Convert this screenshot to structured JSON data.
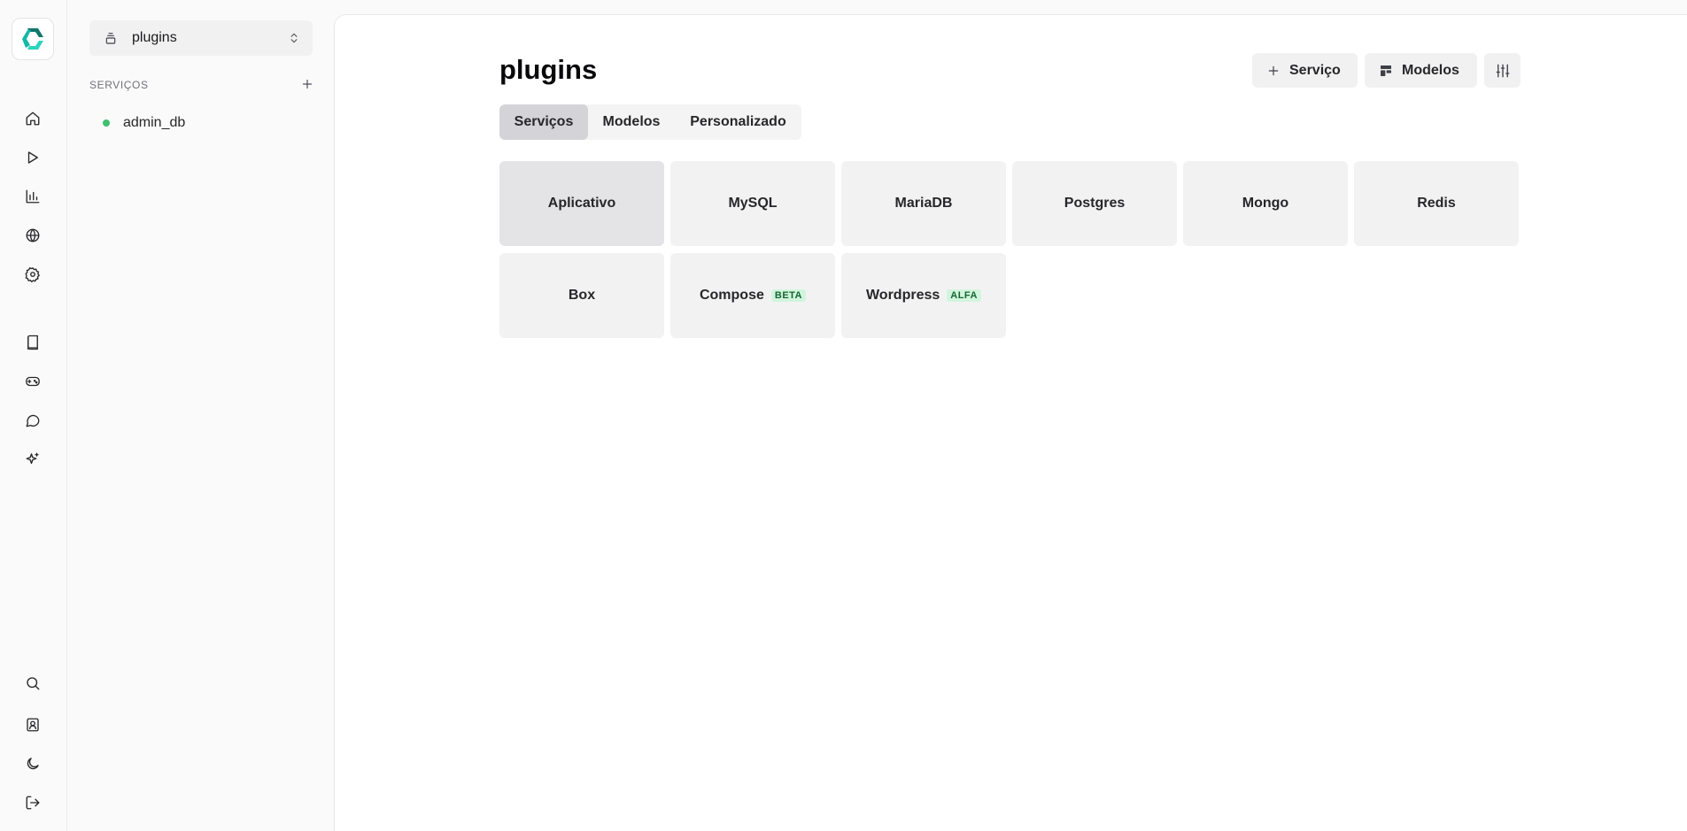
{
  "sidebar_rail": {
    "logo": "dokploy-logo",
    "top_icons": [
      "home-icon",
      "play-icon",
      "bar-chart-icon",
      "globe-icon",
      "settings-icon"
    ],
    "mid_icons": [
      "book-icon",
      "gamepad-icon",
      "message-circle-icon",
      "sparkles-icon"
    ],
    "bottom_icons": [
      "search-icon",
      "user-badge-icon",
      "moon-icon",
      "logout-icon"
    ]
  },
  "panel": {
    "project_name": "plugins",
    "section_title": "SERVIÇOS",
    "services": [
      {
        "name": "admin_db",
        "status_color": "#3fbf6f"
      }
    ]
  },
  "main": {
    "title": "plugins",
    "actions": {
      "service_label": "Serviço",
      "models_label": "Modelos"
    },
    "tabs": [
      {
        "label": "Serviços",
        "active": true
      },
      {
        "label": "Modelos",
        "active": false
      },
      {
        "label": "Personalizado",
        "active": false
      }
    ],
    "cards": [
      {
        "label": "Aplicativo",
        "selected": true
      },
      {
        "label": "MySQL"
      },
      {
        "label": "MariaDB"
      },
      {
        "label": "Postgres"
      },
      {
        "label": "Mongo"
      },
      {
        "label": "Redis"
      },
      {
        "label": "Box"
      },
      {
        "label": "Compose",
        "badge": "BETA"
      },
      {
        "label": "Wordpress",
        "badge": "ALFA"
      }
    ]
  },
  "colors": {
    "accent_logo": "#14b8a6",
    "badge_bg": "#d1f5dc",
    "badge_text": "#166534"
  }
}
